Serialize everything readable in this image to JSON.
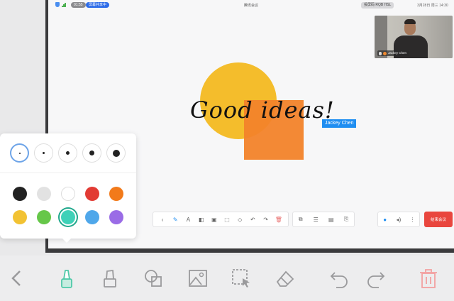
{
  "topbar": {
    "timer": "01:55",
    "share_label": "屏幕共享中",
    "meeting_title": "腾讯会议",
    "projector_label": "投屏码 RQB HSL",
    "datetime": "3月28日 周三 14:30"
  },
  "video": {
    "participant_name": "Jackey Chen"
  },
  "canvas": {
    "handwriting": "Good ideas!",
    "cursor_label": "Jackey Chen",
    "shapes": {
      "circle_color": "#f4bd2c",
      "square_color": "#f2832a"
    }
  },
  "mini_toolbar": {
    "icons": [
      "chevron-left-icon",
      "pen-icon",
      "marker-icon",
      "shapes-icon",
      "image-icon",
      "select-icon",
      "eraser-icon",
      "undo-icon",
      "redo-icon",
      "delete-icon"
    ],
    "right_icons": [
      "screenshot-icon",
      "layers-icon",
      "save-icon",
      "export-icon"
    ],
    "device_icons": [
      "mic-icon",
      "speaker-icon",
      "more-icon"
    ],
    "end_label": "结束会议"
  },
  "pen_popover": {
    "sizes": [
      "xs",
      "s",
      "m",
      "l",
      "xl"
    ],
    "selected_size": "xs",
    "colors": [
      "#222222",
      "#e2e2e2",
      "#ffffff",
      "#e23b34",
      "#f27a1a",
      "#f2c233",
      "#66c749",
      "#3fd1b8",
      "#4fa7ea",
      "#9a6ce6"
    ],
    "selected_color": "#3fd1b8"
  },
  "bottom_toolbar": {
    "icons": [
      "back-icon",
      "pen-icon",
      "highlighter-icon",
      "shapes-icon",
      "image-icon",
      "select-icon",
      "eraser-icon",
      "undo-icon",
      "redo-icon",
      "trash-icon"
    ],
    "accent": "#4fc9a8",
    "danger": "#f3a1a1"
  }
}
